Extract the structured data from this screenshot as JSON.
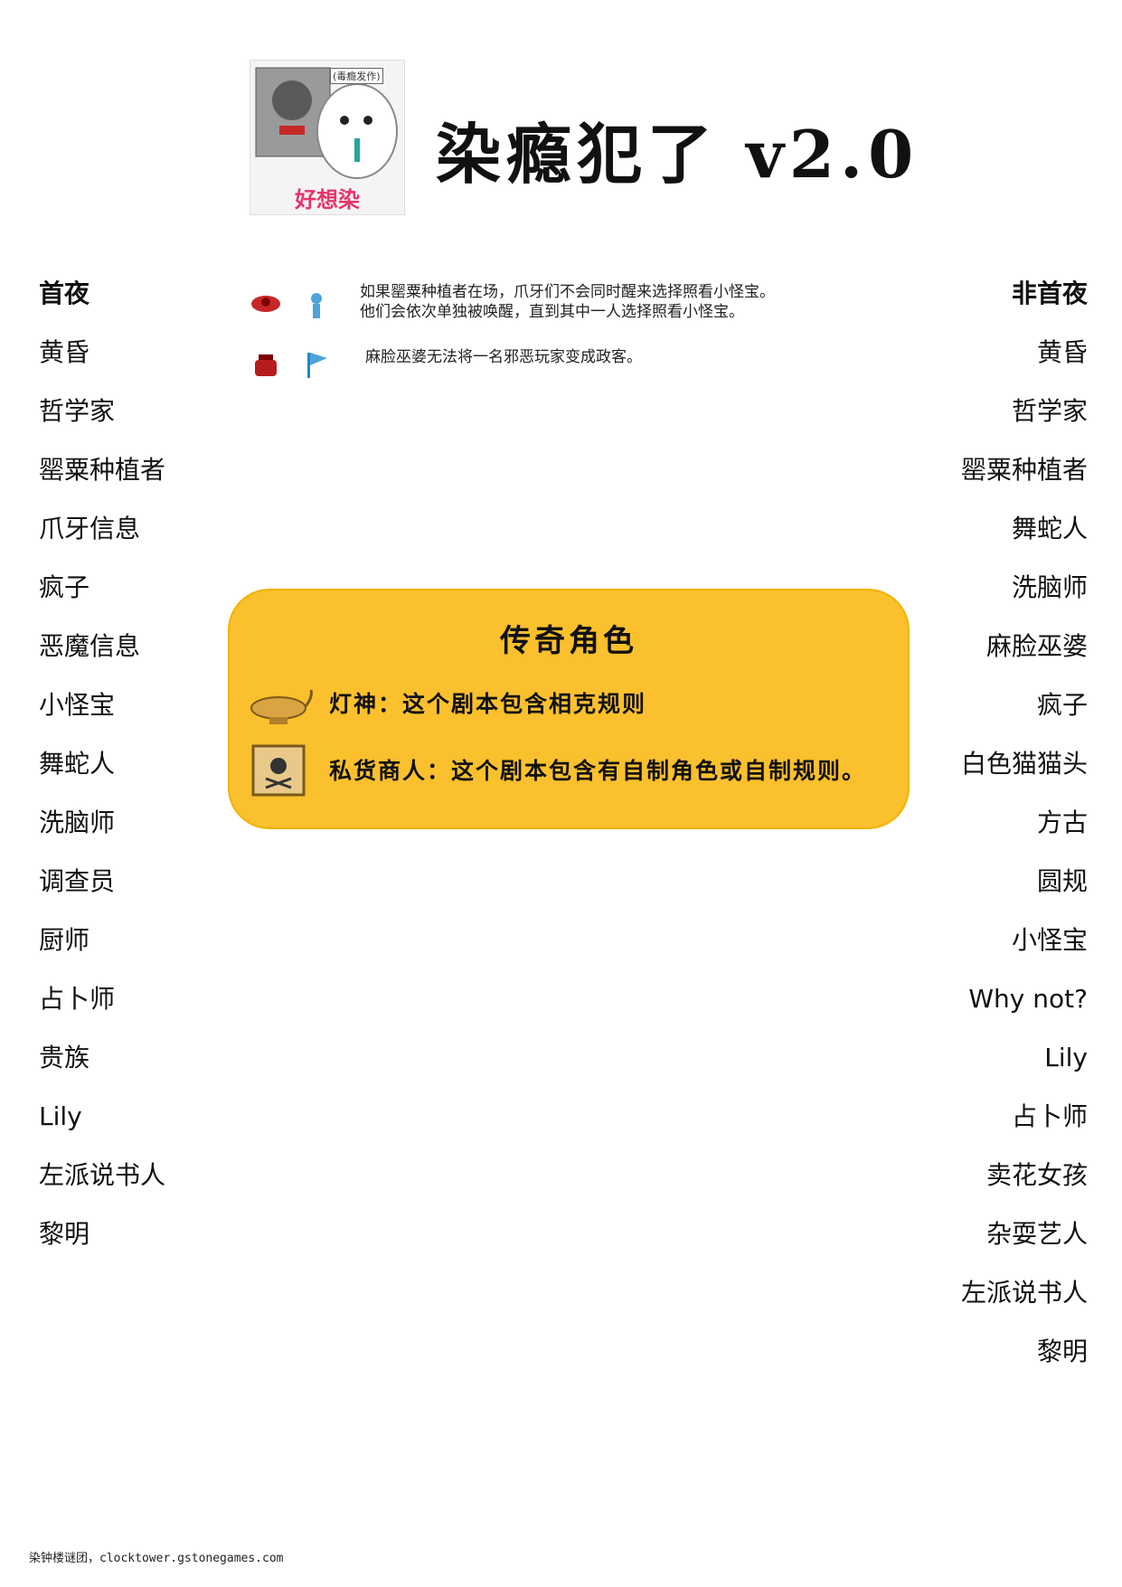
{
  "header": {
    "title": "染瘾犯了 v2.0",
    "logo_caption": "好想染",
    "logo_tag": "(毒瘾发作)"
  },
  "first_night": {
    "heading": "首夜",
    "items": [
      "黄昏",
      "哲学家",
      "罂粟种植者",
      "爪牙信息",
      "疯子",
      "恶魔信息",
      "小怪宝",
      "舞蛇人",
      "洗脑师",
      "调查员",
      "厨师",
      "占卜师",
      "贵族",
      "Lily",
      "左派说书人",
      "黎明"
    ]
  },
  "other_nights": {
    "heading": "非首夜",
    "items": [
      "黄昏",
      "哲学家",
      "罂粟种植者",
      "舞蛇人",
      "洗脑师",
      "麻脸巫婆",
      "疯子",
      "白色猫猫头",
      "方古",
      "圆规",
      "小怪宝",
      "Why  not?",
      "Lily",
      "占卜师",
      "卖花女孩",
      "杂耍艺人",
      "左派说书人",
      "黎明"
    ]
  },
  "jinxes": [
    {
      "icons": [
        "poppy-grower-icon",
        "lil-monsta-icon"
      ],
      "lines": [
        "如果罂粟种植者在场，爪牙们不会同时醒来选择照看小怪宝。",
        "他们会依次单独被唤醒，直到其中一人选择照看小怪宝。"
      ]
    },
    {
      "icons": [
        "pit-hag-icon",
        "politician-icon"
      ],
      "lines": [
        "麻脸巫婆无法将一名邪恶玩家变成政客。"
      ]
    }
  ],
  "legendary": {
    "title": "传奇角色",
    "rows": [
      {
        "icon": "genie-lamp-icon",
        "text": "灯神：这个剧本包含相克规则"
      },
      {
        "icon": "smuggler-crate-icon",
        "text": "私货商人：这个剧本包含有自制角色或自制规则。"
      }
    ]
  },
  "footer": "染钟楼谜团，clocktower.gstonegames.com",
  "colors": {
    "legend_bg": "#fbc02d",
    "logo_caption": "#e8336b"
  }
}
